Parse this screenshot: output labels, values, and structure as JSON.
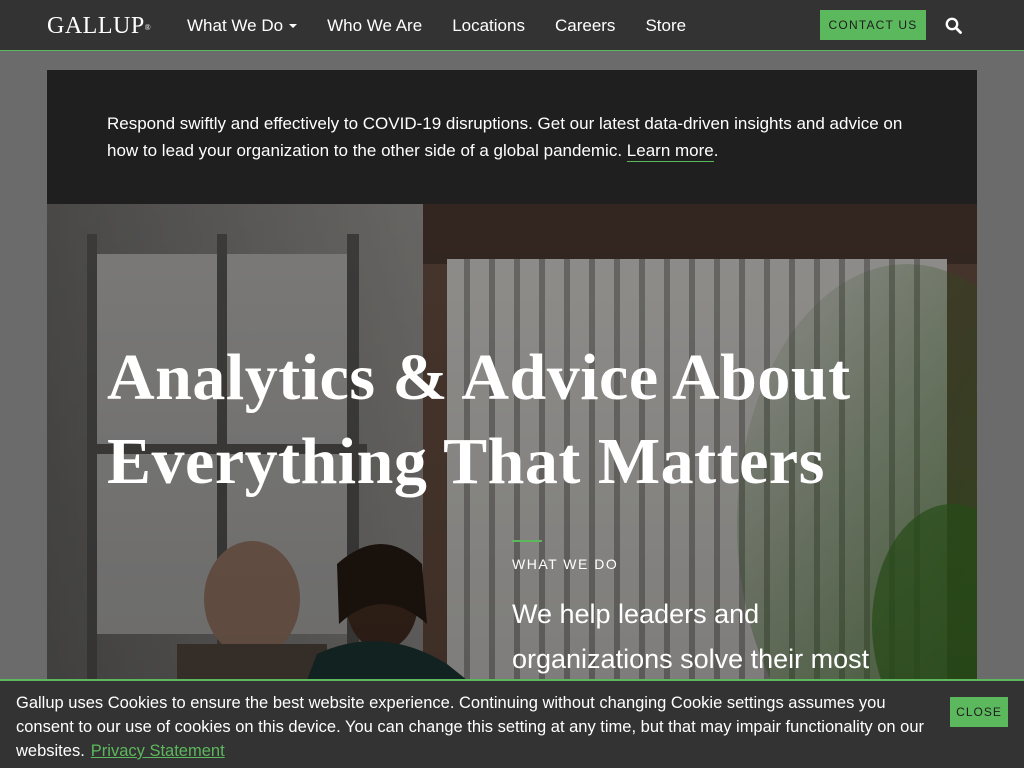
{
  "header": {
    "logo": "GALLUP",
    "logo_mark": "®",
    "nav": [
      {
        "label": "What We Do",
        "has_dropdown": true
      },
      {
        "label": "Who We Are"
      },
      {
        "label": "Locations"
      },
      {
        "label": "Careers"
      },
      {
        "label": "Store"
      }
    ],
    "contact_label": "CONTACT US",
    "search_icon": "search-icon"
  },
  "banner": {
    "text": "Respond swiftly and effectively to COVID-19 disruptions. Get our latest data-driven insights and advice on how to lead your organization to the other side of a global pandemic.",
    "link_label": "Learn more",
    "after_link": "."
  },
  "hero": {
    "title": "Analytics & Advice About Everything That Matters",
    "kicker": "WHAT WE DO",
    "subtitle": "We help leaders and organizations solve their most"
  },
  "cookie": {
    "text": "Gallup uses Cookies to ensure the best website experience. Continuing without changing Cookie settings assumes you consent to our use of cookies on this device. You can change this setting at any time, but that may impair functionality on our websites.",
    "link_label": "Privacy Statement",
    "close_label": "CLOSE"
  },
  "colors": {
    "accent": "#5cb85c",
    "nav_bg": "#333333",
    "banner_bg": "#1f1f1f"
  }
}
